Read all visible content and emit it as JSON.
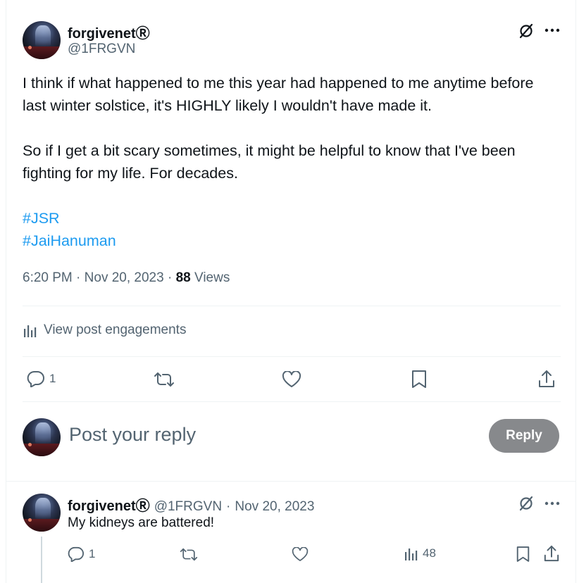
{
  "post": {
    "author_name": "forgivenetⓇ",
    "author_handle": "@1FRGVN",
    "paragraph1": "I think if what happened to me this year had happened to me anytime before last winter solstice, it's HIGHLY likely I wouldn't have made it.",
    "paragraph2": "So if I get a bit scary sometimes, it might be helpful to know that I've been fighting for my life. For decades.",
    "hashtags": [
      "#JSR",
      "#JaiHanuman"
    ],
    "time": "6:20 PM",
    "date": "Nov 20, 2023",
    "views_count": "88",
    "views_label": "Views",
    "engagements_label": "View post engagements",
    "reply_count": "1",
    "icons": {
      "grok": "grok-slash-circle-icon",
      "more": "more-horizontal-icon",
      "reply": "reply-bubble-icon",
      "repost": "repost-icon",
      "like": "heart-icon",
      "bookmark": "bookmark-icon",
      "share": "share-upload-icon",
      "analytics": "bar-chart-icon"
    }
  },
  "composer": {
    "placeholder": "Post your reply",
    "button_label": "Reply",
    "button_color": "#87898c"
  },
  "reply": {
    "author_name": "forgivenetⓇ",
    "author_handle": "@1FRGVN",
    "separator": "·",
    "date": "Nov 20, 2023",
    "text": "My kidneys are battered!",
    "reply_count": "1",
    "views_count": "48"
  },
  "colors": {
    "link": "#1d9bf0",
    "muted": "#536471",
    "text": "#0f1419",
    "divider": "#eff3f4"
  }
}
